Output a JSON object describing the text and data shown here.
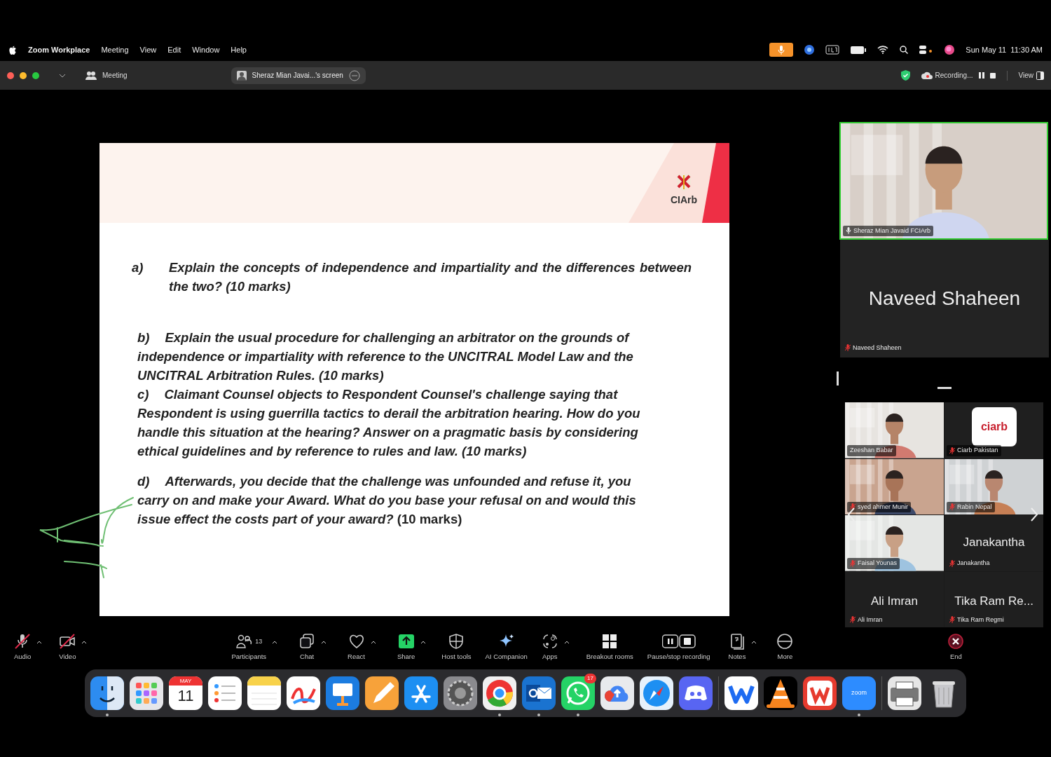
{
  "menu_bar": {
    "app": "Zoom Workplace",
    "menus": [
      "Meeting",
      "View",
      "Edit",
      "Window",
      "Help"
    ],
    "clock": "Sun May 11  11:30 AM"
  },
  "title_bar": {
    "meeting_label": "Meeting",
    "share_pill": "Sheraz Mian Javai...'s screen",
    "recording": "Recording...",
    "view": "View"
  },
  "slide": {
    "logo": "CIArb",
    "questions": [
      {
        "kind": "hanging",
        "label": "a)",
        "text": "Explain the concepts of independence and impartiality and the differences between the two? (10 marks)"
      },
      {
        "kind": "inline",
        "label": "b)",
        "text": "Explain the usual procedure for challenging an arbitrator on the grounds of independence or impartiality with reference to the UNCITRAL Model Law and the  UNCITRAL Arbitration Rules.  (10 marks)"
      },
      {
        "kind": "inline",
        "label": "c)",
        "text": "Claimant Counsel objects to Respondent Counsel's challenge saying that Respondent is using guerrilla tactics to derail the arbitration hearing. How do you handle this situation at the hearing? Answer on a pragmatic basis by considering ethical guidelines and by reference to rules and law. (10 marks)"
      },
      {
        "kind": "inline",
        "label": "d)",
        "text": "Afterwards, you decide that the challenge was unfounded and refuse it, you carry on and make your Award. What do you base your refusal on and would this issue effect the costs part of your award?",
        "suffix": "(10 marks)"
      }
    ]
  },
  "speaker": {
    "name": "Sheraz Mian Javaid FCIArb",
    "muted": false,
    "active": true
  },
  "name_tile": {
    "display_name": "Naveed Shaheen",
    "name": "Naveed Shaheen",
    "muted": true
  },
  "gallery": [
    {
      "kind": "video",
      "name": "Zeeshan Babar",
      "muted": false
    },
    {
      "kind": "logo",
      "logo_text": "ciarb",
      "name": "Ciarb Pakistan",
      "muted": true
    },
    {
      "kind": "video",
      "name": "syed ahmer Munir",
      "muted": true
    },
    {
      "kind": "video",
      "name": "Rabin Nepal",
      "muted": true
    },
    {
      "kind": "video",
      "name": "Faisal Younas",
      "muted": true
    },
    {
      "kind": "name",
      "display_name": "Janakantha",
      "name": "Janakantha",
      "muted": true
    },
    {
      "kind": "name",
      "display_name": "Ali Imran",
      "name": "Ali Imran",
      "muted": true
    },
    {
      "kind": "name",
      "display_name": "Tika Ram Re...",
      "name": "Tika Ram Regmi",
      "muted": true
    }
  ],
  "toolbar": [
    {
      "kind": "audio",
      "label": "Audio",
      "off": true,
      "caret": true
    },
    {
      "kind": "video",
      "label": "Video",
      "off": true,
      "caret": true
    },
    {
      "kind": "participants",
      "label": "Participants",
      "count": "13",
      "caret": true
    },
    {
      "kind": "chat",
      "label": "Chat",
      "caret": true
    },
    {
      "kind": "react",
      "label": "React",
      "caret": true
    },
    {
      "kind": "share",
      "label": "Share",
      "caret": true
    },
    {
      "kind": "host",
      "label": "Host tools",
      "caret": false
    },
    {
      "kind": "ai",
      "label": "AI Companion",
      "caret": false
    },
    {
      "kind": "apps",
      "label": "Apps",
      "caret": true
    },
    {
      "kind": "breakout",
      "label": "Breakout rooms",
      "caret": false
    },
    {
      "kind": "record",
      "label": "Pause/stop recording",
      "caret": false
    },
    {
      "kind": "notes",
      "label": "Notes",
      "caret": true
    },
    {
      "kind": "more",
      "label": "More",
      "caret": false
    },
    {
      "kind": "end",
      "label": "End",
      "caret": false
    }
  ],
  "dock": [
    {
      "kind": "smiley",
      "running": true
    },
    {
      "kind": "grid",
      "running": false
    },
    {
      "kind": "calendar",
      "month": "MAY",
      "day": "11",
      "running": false
    },
    {
      "kind": "list",
      "running": false
    },
    {
      "kind": "notepad",
      "running": false
    },
    {
      "kind": "squiggle",
      "running": false
    },
    {
      "kind": "podium",
      "running": false
    },
    {
      "kind": "pencil",
      "running": false
    },
    {
      "kind": "appstore",
      "running": false
    },
    {
      "kind": "gear",
      "running": false
    },
    {
      "kind": "ring",
      "running": true
    },
    {
      "kind": "envelope",
      "running": true
    },
    {
      "kind": "phone",
      "badge": "17",
      "running": true
    },
    {
      "kind": "cloud",
      "running": false
    },
    {
      "kind": "compass",
      "running": false
    },
    {
      "kind": "gamepad",
      "running": false
    },
    {
      "kind": "zigzag",
      "running": false,
      "group_start": true
    },
    {
      "kind": "cone",
      "running": false
    },
    {
      "kind": "zigzag-red",
      "running": false
    },
    {
      "kind": "zoom",
      "label": "zoom",
      "running": true
    },
    {
      "kind": "printer",
      "running": false,
      "group_start": true
    },
    {
      "kind": "trash",
      "running": false
    }
  ]
}
